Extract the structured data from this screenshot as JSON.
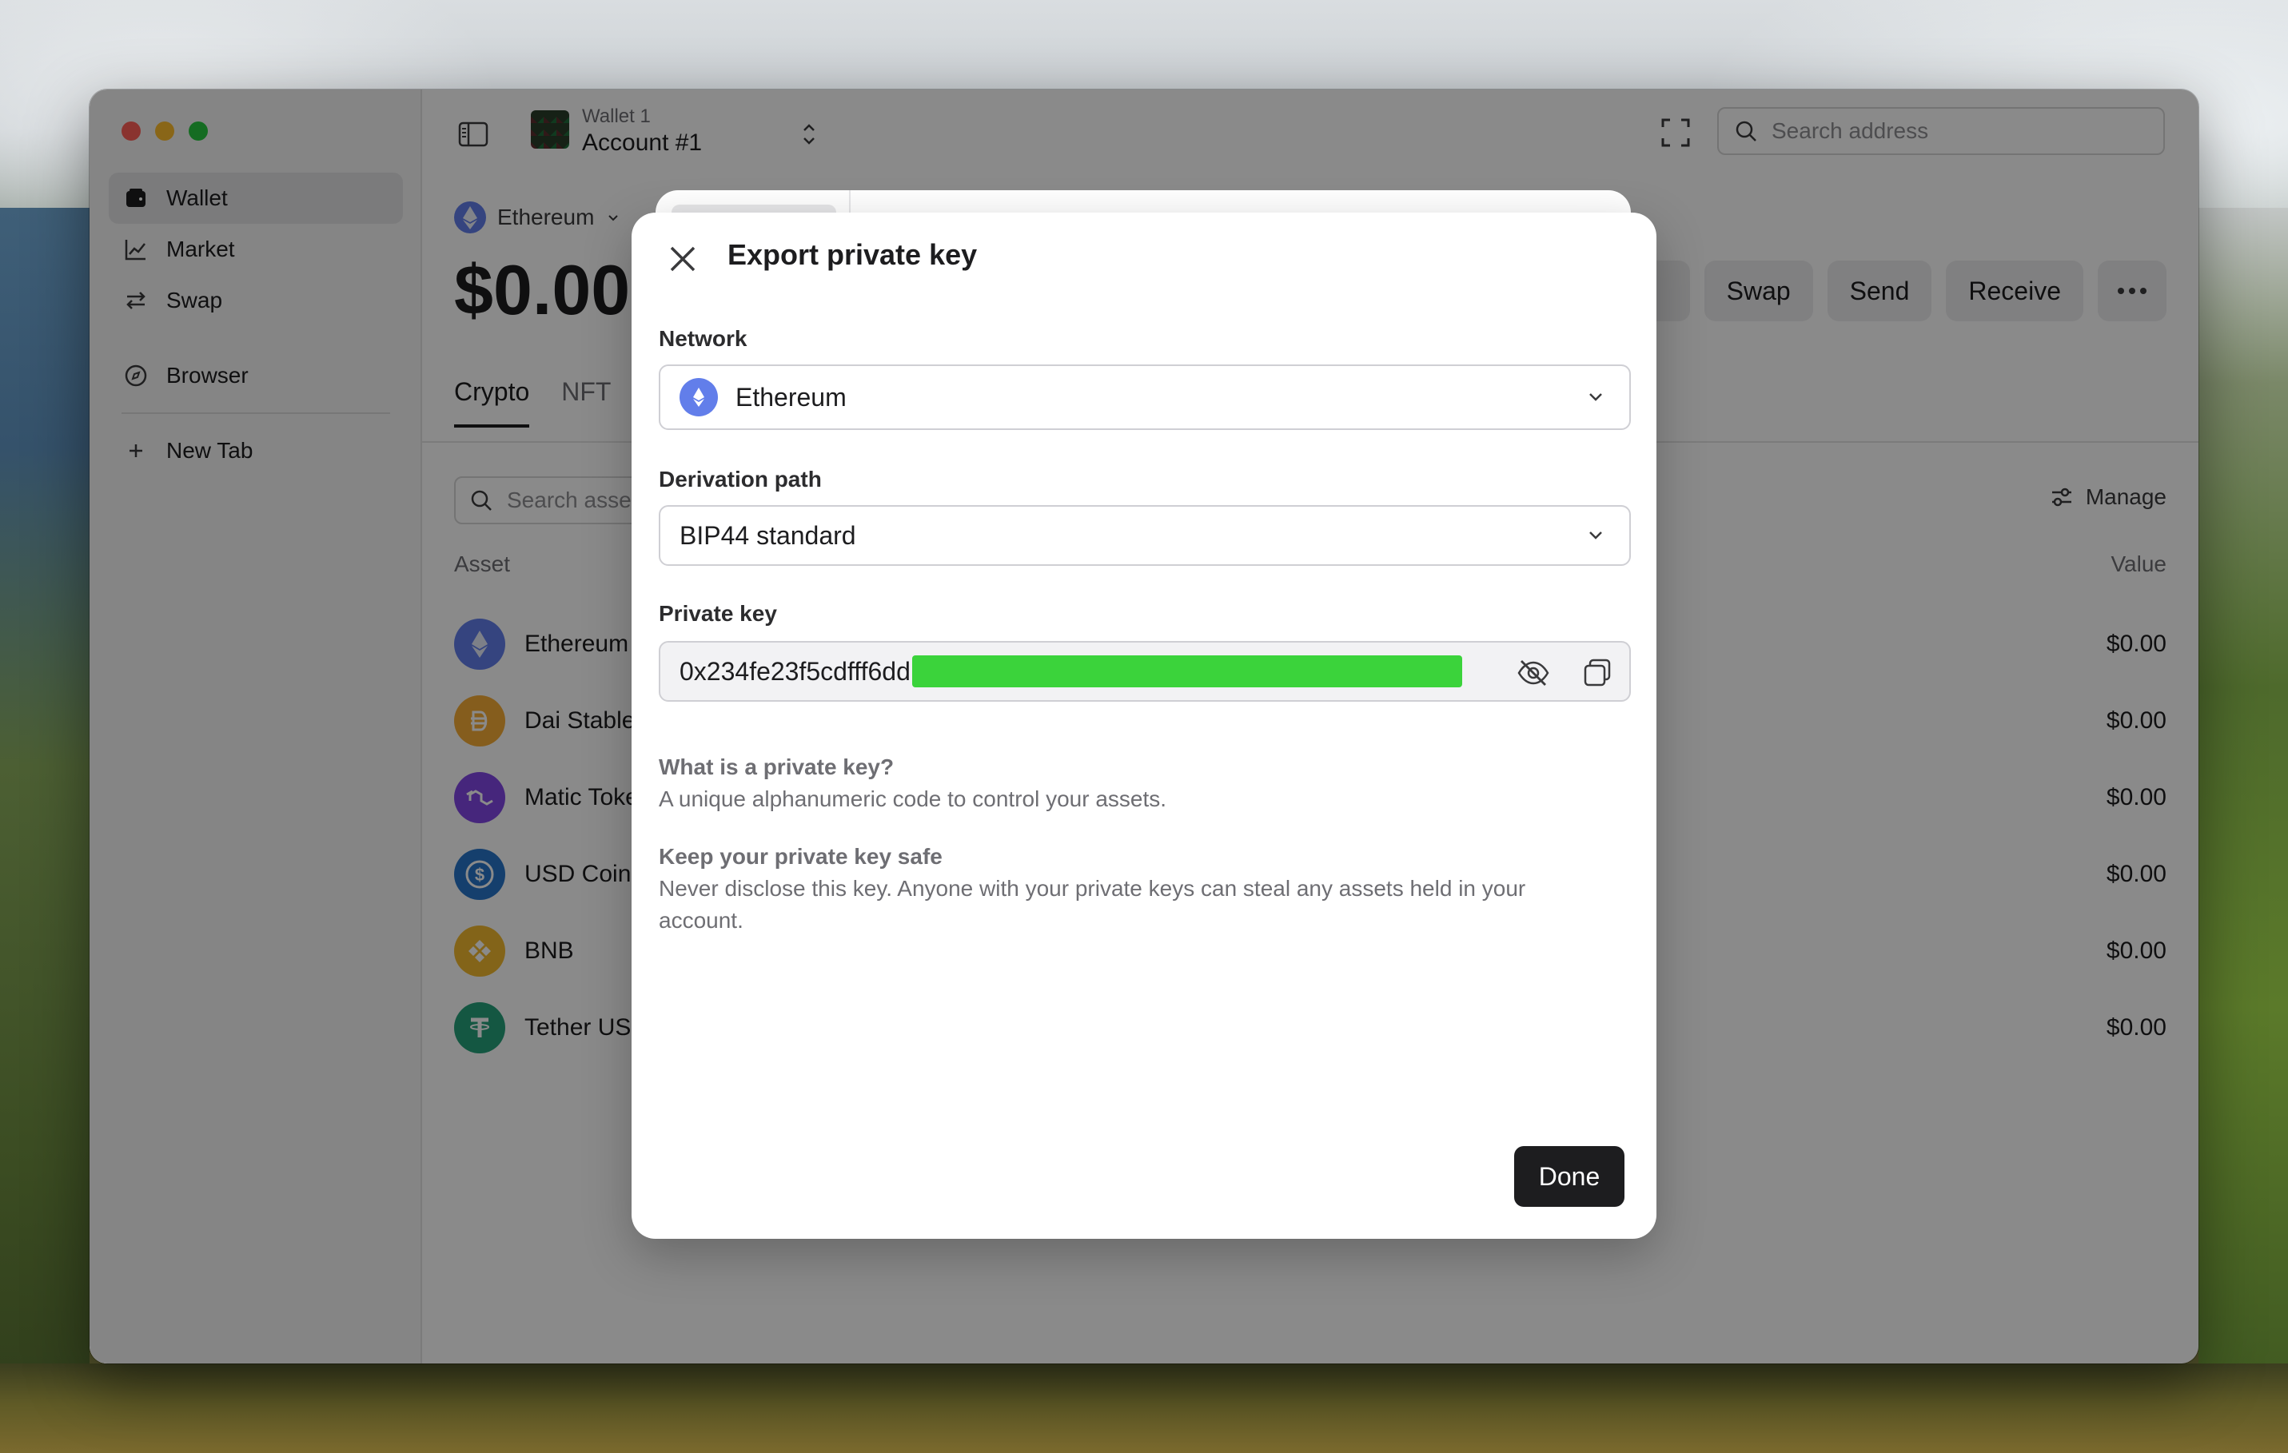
{
  "colors": {
    "accent": "#627eea",
    "redaction": "#3bd33b",
    "traffic_close": "#ff5f57",
    "traffic_min": "#febc2e",
    "traffic_max": "#28c840"
  },
  "sidebar": {
    "items": [
      {
        "label": "Wallet",
        "icon": "wallet-icon",
        "active": true
      },
      {
        "label": "Market",
        "icon": "chart-icon"
      },
      {
        "label": "Swap",
        "icon": "swap-icon"
      },
      {
        "label": "Browser",
        "icon": "compass-icon"
      },
      {
        "label": "New Tab",
        "icon": "plus-icon"
      }
    ]
  },
  "header": {
    "wallet_name": "Wallet 1",
    "account_name": "Account #1",
    "search_placeholder": "Search address"
  },
  "main": {
    "network": "Ethereum",
    "balance": "$0.00",
    "actions": [
      "Swap",
      "Send",
      "Receive"
    ],
    "tabs": [
      "Crypto",
      "NFT"
    ],
    "asset_search_placeholder": "Search asse",
    "manage_label": "Manage",
    "col_asset": "Asset",
    "col_value": "Value",
    "assets": [
      {
        "name": "Ethereum",
        "value": "$0.00",
        "color": "#627eea"
      },
      {
        "name": "Dai Stable",
        "value": "$0.00",
        "color": "#f5ac37"
      },
      {
        "name": "Matic Toke",
        "value": "$0.00",
        "color": "#8247e5"
      },
      {
        "name": "USD Coin",
        "value": "$0.00",
        "color": "#2775ca"
      },
      {
        "name": "BNB",
        "value": "$0.00",
        "color": "#f3ba2f"
      },
      {
        "name": "Tether USI",
        "value": "$0.00",
        "color": "#26a17b"
      }
    ]
  },
  "modal": {
    "title": "Export private key",
    "network_label": "Network",
    "network_value": "Ethereum",
    "path_label": "Derivation path",
    "path_value": "BIP44 standard",
    "pk_label": "Private key",
    "pk_visible": "0x234fe23f5cdfff6dd",
    "info1_title": "What is a private key?",
    "info1_text": "A unique alphanumeric code to control your assets.",
    "info2_title": "Keep your private key safe",
    "info2_text": "Never disclose this key. Anyone with your private keys can steal any assets held in your account.",
    "done_label": "Done"
  }
}
